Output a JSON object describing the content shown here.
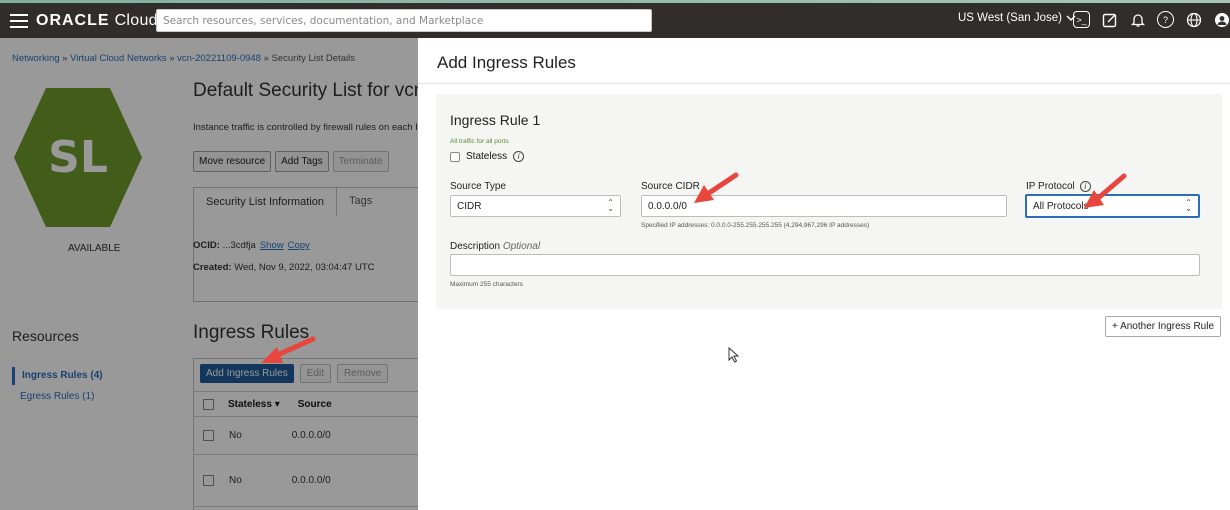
{
  "topbar": {
    "brand_oracle": "ORACLE",
    "brand_cloud": "Cloud",
    "search_placeholder": "Search resources, services, documentation, and Marketplace",
    "region": "US West (San Jose)",
    "icons": [
      "cloud-shell-icon",
      "edit-icon",
      "bell-icon",
      "help-icon",
      "globe-icon",
      "user-icon"
    ]
  },
  "breadcrumb": {
    "networking": "Networking",
    "vcn_list": "Virtual Cloud Networks",
    "vcn": "vcn-20221109-0948",
    "current": "Security List Details",
    "sep": "»"
  },
  "resource": {
    "badge_text": "SL",
    "status": "AVAILABLE",
    "title": "Default Security List for vcn-",
    "description": "Instance traffic is controlled by firewall rules on each Insta",
    "actions": [
      "Move resource",
      "Add Tags",
      "Terminate"
    ],
    "tabs": [
      "Security List Information",
      "Tags"
    ],
    "info": {
      "ocid_label": "OCID:",
      "ocid_value": "...3cdfja",
      "show": "Show",
      "copy": "Copy",
      "created_label": "Created:",
      "created_value": "Wed, Nov 9, 2022, 03:04:47 UTC"
    }
  },
  "resources_nav": {
    "title": "Resources",
    "items": [
      "Ingress Rules (4)",
      "Egress Rules (1)"
    ]
  },
  "ingress_list": {
    "title": "Ingress Rules",
    "add_button": "Add Ingress Rules",
    "edit_button": "Edit",
    "remove_button": "Remove",
    "columns": [
      "Stateless",
      "Source"
    ],
    "rows": [
      {
        "stateless": "No",
        "source": "0.0.0.0/0"
      },
      {
        "stateless": "No",
        "source": "0.0.0.0/0"
      }
    ]
  },
  "panel": {
    "title": "Add Ingress Rules",
    "rule_title": "Ingress Rule 1",
    "rule_subtitle": "All traffic for all ports",
    "stateless_label": "Stateless",
    "source_type_label": "Source Type",
    "source_type_value": "CIDR",
    "source_cidr_label": "Source CIDR",
    "source_cidr_value": "0.0.0.0/0",
    "source_cidr_hint": "Specified IP addresses: 0.0.0.0-255.255.255.255 (4,294,967,296 IP addresses)",
    "ip_protocol_label": "IP Protocol",
    "ip_protocol_value": "All Protocols",
    "description_label": "Description",
    "description_optional": "Optional",
    "description_value": "",
    "description_hint": "Maximum 255 characters",
    "another_rule_button": "+ Another Ingress Rule"
  },
  "colors": {
    "topbar": "#312d2a",
    "primary": "#1f5b9a",
    "link": "#2a6ebb",
    "badge": "#6e9c2c",
    "annotation_arrow": "#e8453c"
  }
}
